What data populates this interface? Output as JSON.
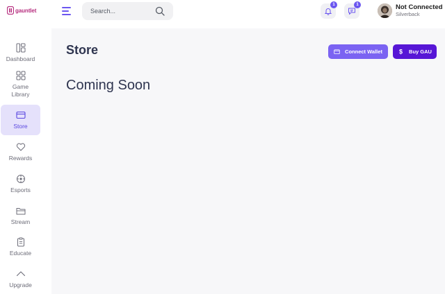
{
  "brand": {
    "name": "gauntlet",
    "color": "#b62d7e"
  },
  "header": {
    "search_placeholder": "Search...",
    "notifications": {
      "count": "1",
      "icon": "bell-icon"
    },
    "messages": {
      "count": "1",
      "icon": "chat-icon"
    },
    "profile": {
      "status": "Not Connected",
      "username": "Silverback"
    }
  },
  "sidebar": {
    "items": [
      {
        "label": "Dashboard",
        "icon": "dashboard-icon",
        "active": false
      },
      {
        "label": "Game\nLibrary",
        "icon": "grid-icon",
        "active": false
      },
      {
        "label": "Store",
        "icon": "card-icon",
        "active": true
      },
      {
        "label": "Rewards",
        "icon": "heart-icon",
        "active": false
      },
      {
        "label": "Esports",
        "icon": "target-icon",
        "active": false
      },
      {
        "label": "Stream",
        "icon": "folder-icon",
        "active": false
      },
      {
        "label": "Educate",
        "icon": "clipboard-icon",
        "active": false
      },
      {
        "label": "Upgrade",
        "icon": "chevron-up-icon",
        "active": false
      }
    ]
  },
  "main": {
    "title": "Store",
    "message": "Coming Soon",
    "connect_wallet_label": "Connect Wallet",
    "buy_label": "Buy GAU"
  },
  "colors": {
    "accent": "#6b56f0",
    "buy": "#5716d6",
    "connect": "#7b63f2",
    "active_bg": "#e5e1fb"
  }
}
